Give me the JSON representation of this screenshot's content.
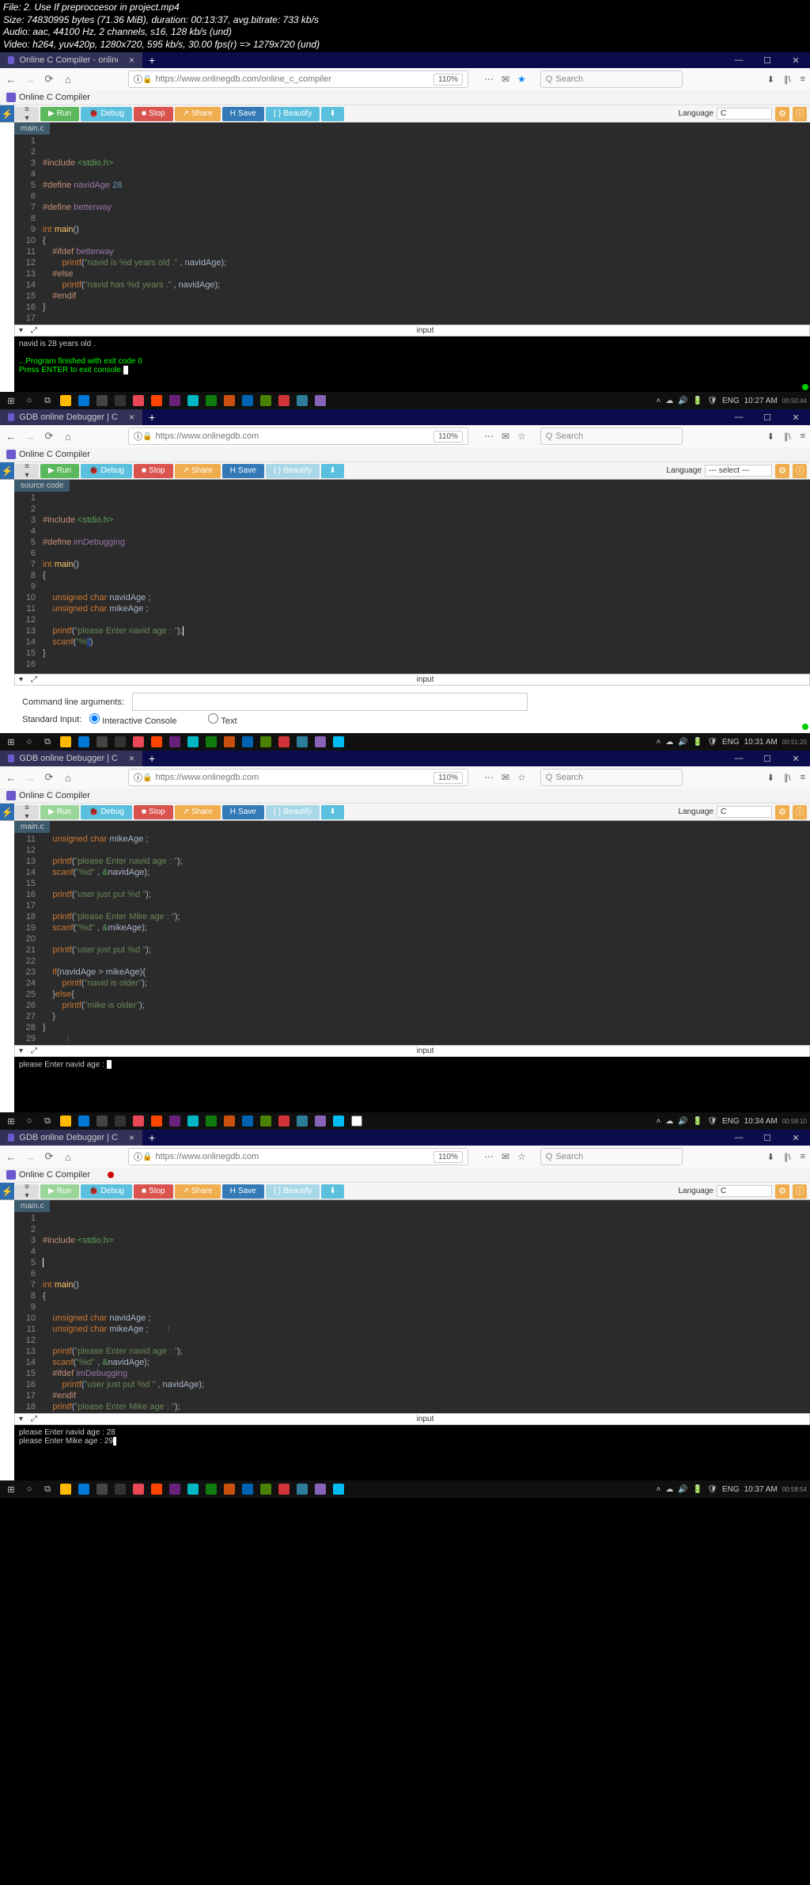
{
  "meta": {
    "file": "File: 2. Use If preproccesor in project.mp4",
    "size": "Size: 74830995 bytes (71.36 MiB), duration: 00:13:37, avg.bitrate: 733 kb/s",
    "audio": "Audio: aac, 44100 Hz, 2 channels, s16, 128 kb/s (und)",
    "video": "Video: h264, yuv420p, 1280x720, 595 kb/s, 30.00 fps(r) => 1279x720 (und)"
  },
  "tabs": {
    "s1": "Online C Compiler - online edi",
    "s2": "GDB online Debugger | Compi",
    "s3": "GDB online Debugger | Compi",
    "s4": "GDB online Debugger | Compi"
  },
  "urls": {
    "s1": "https://www.onlinegdb.com/online_c_compiler",
    "s2": "https://www.onlinegdb.com",
    "s3": "https://www.onlinegdb.com",
    "s4": "https://www.onlinegdb.com"
  },
  "zoom": "110%",
  "search_ph": "Search",
  "subbar_label": "Online C Compiler",
  "toolbar": {
    "run": "Run",
    "debug": "Debug",
    "stop": "Stop",
    "share": "Share",
    "save": "Save",
    "beautify": "Beautify"
  },
  "lang_label": "Language",
  "lang_c": "C",
  "lang_select": "--- select ---",
  "file_main": "main.c",
  "file_src": "source code",
  "input_label": "input",
  "cli_label": "Command line arguments:",
  "stdin_label": "Standard Input:",
  "stdin_opt1": "Interactive Console",
  "stdin_opt2": "Text",
  "clock": {
    "s1": "10:27 AM",
    "s2": "10:31 AM",
    "s3": "10:34 AM",
    "s4": "10:37 AM"
  },
  "eng": "ENG",
  "ts_overlay": {
    "s1": "00:50:44",
    "s2": "00:51:20",
    "s3": "00:58:10",
    "s4": "00:58:54"
  },
  "code1": {
    "l3": "#include <stdio.h>",
    "l5": "#define navidAge 28",
    "l7": "#define betterway",
    "l9": "int main()",
    "l10": "{",
    "l11": "    #ifdef betterway",
    "l12": "        printf(\"navid is %d years old .\" , navidAge);",
    "l13": "    #else",
    "l14": "        printf(\"navid has %d years .\" , navidAge);",
    "l15": "    #endif",
    "l16": "}"
  },
  "console1": {
    "l1": "navid is 28 years old .",
    "l2": "...Program finished with exit code 0",
    "l3": "Press ENTER to exit console."
  },
  "code2": {
    "l3": "#include <stdio.h>",
    "l5": "#define imDebugging",
    "l7": "int main()",
    "l8": "{",
    "l10": "    unsigned char navidAge ;",
    "l11": "    unsigned char mikeAge ;",
    "l13": "    printf(\"please Enter navid age : \");",
    "l14": "    scanf(\"%\")",
    "l15": "}"
  },
  "code3": {
    "l11": "    unsigned char mikeAge ;",
    "l13": "    printf(\"please Enter navid age : \");",
    "l14": "    scanf(\"%d\" , &navidAge);",
    "l16": "    printf(\"user just put %d \");",
    "l18": "    printf(\"please Enter Mike age : \");",
    "l19": "    scanf(\"%d\" , &mikeAge);",
    "l21": "    printf(\"user just put %d \");",
    "l23": "    if(navidAge > mikeAge){",
    "l24": "        printf(\"navid is older\");",
    "l25": "    }else{",
    "l26": "        printf(\"mike is older\");",
    "l27": "    }",
    "l28": "}"
  },
  "console3": "please Enter navid age : ",
  "code4": {
    "l3": "#include <stdio.h>",
    "l7": "int main()",
    "l8": "{",
    "l10": "    unsigned char navidAge ;",
    "l11": "    unsigned char mikeAge ;",
    "l13": "    printf(\"please Enter navid age : \");",
    "l14": "    scanf(\"%d\" , &navidAge);",
    "l15": "    #ifdef imDebugging",
    "l16": "        printf(\"user just put %d \" , navidAge);",
    "l17": "    #endif",
    "l18": "    printf(\"please Enter Mike age : \");"
  },
  "console4": {
    "l1": "please Enter navid age : 28",
    "l2": "please Enter Mike age : 29"
  }
}
